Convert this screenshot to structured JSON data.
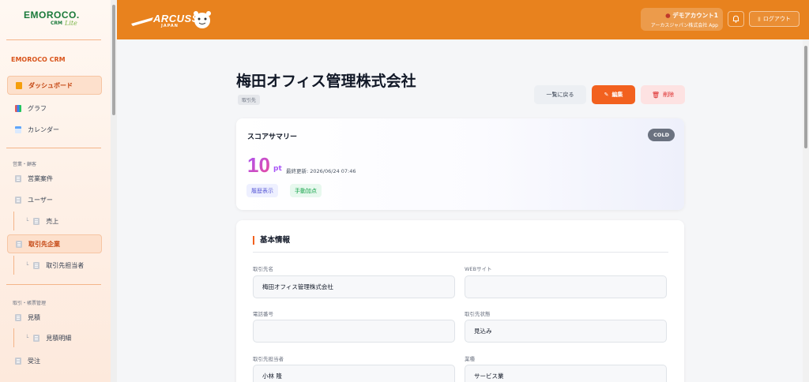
{
  "sidebar": {
    "logo_main": "EMOROCO.",
    "logo_crm": "CRM",
    "logo_lite": "Lite",
    "title": "EMOROCO CRM",
    "items_top": [
      {
        "label": "ダッシュボード",
        "icon": "home-icon"
      },
      {
        "label": "グラフ",
        "icon": "chart-icon"
      },
      {
        "label": "カレンダー",
        "icon": "calendar-icon"
      }
    ],
    "section_sales": "営業・顧客",
    "sales_items": [
      {
        "label": "営業案件"
      },
      {
        "label": "ユーザー"
      },
      {
        "label": "売上"
      },
      {
        "label": "取引先企業"
      },
      {
        "label": "取引先担当者"
      }
    ],
    "section_trade": "取引・帳票管理",
    "trade_items": [
      {
        "label": "見積"
      },
      {
        "label": "見積明細"
      },
      {
        "label": "受注"
      }
    ]
  },
  "header": {
    "brand": "ARCUSS",
    "brand_sub": "JAPAN",
    "account_name": "デモアカウント1",
    "account_company": "アーカスジャパン株式会社 App",
    "logout_label": "ログアウト"
  },
  "page": {
    "title": "梅田オフィス管理株式会社",
    "type_badge": "取引先",
    "back_label": "一覧に戻る",
    "edit_label": "編集",
    "delete_label": "削除"
  },
  "score": {
    "title": "スコアサマリー",
    "status": "COLD",
    "value": "10",
    "unit": "pt",
    "updated": "最終更新: 2026/06/24 07:46",
    "history_label": "履歴表示",
    "manual_label": "手動加点"
  },
  "info": {
    "section_title": "基本情報",
    "fields": [
      {
        "label": "取引先名",
        "value": "梅田オフィス管理株式会社"
      },
      {
        "label": "WEBサイト",
        "value": ""
      },
      {
        "label": "電話番号",
        "value": ""
      },
      {
        "label": "取引先状態",
        "value": "見込み"
      },
      {
        "label": "取引先担当者",
        "value": "小林 隆"
      },
      {
        "label": "業種",
        "value": "サービス業"
      }
    ]
  },
  "colors": {
    "header": "#e8821e",
    "accent": "#f2611f",
    "cold_badge": "#6b7280"
  }
}
